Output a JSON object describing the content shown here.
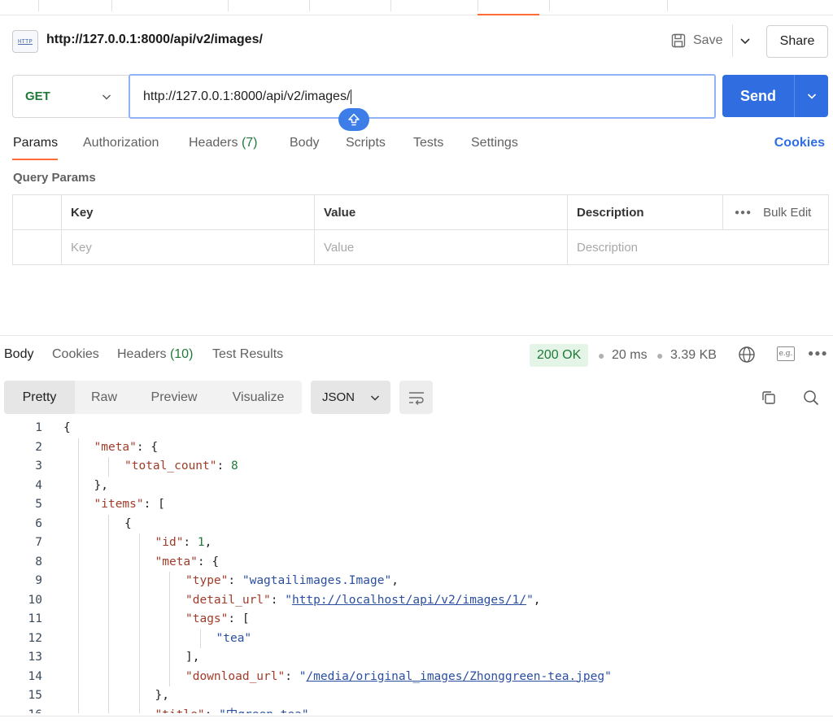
{
  "request": {
    "title": "http://127.0.0.1:8000/api/v2/images/",
    "http_icon_label": "HTTP",
    "save_label": "Save",
    "share_label": "Share",
    "method": "GET",
    "url": "http://127.0.0.1:8000/api/v2/images/",
    "send_label": "Send"
  },
  "request_tabs": {
    "params": "Params",
    "authorization": "Authorization",
    "headers": "Headers",
    "headers_count": "(7)",
    "body": "Body",
    "scripts": "Scripts",
    "tests": "Tests",
    "settings": "Settings",
    "cookies": "Cookies"
  },
  "query_params": {
    "label": "Query Params",
    "headers": {
      "key": "Key",
      "value": "Value",
      "description": "Description",
      "bulk_edit": "Bulk Edit"
    },
    "placeholders": {
      "key": "Key",
      "value": "Value",
      "description": "Description"
    }
  },
  "response": {
    "tabs": {
      "body": "Body",
      "cookies": "Cookies",
      "headers": "Headers",
      "headers_count": "(10)",
      "test_results": "Test Results"
    },
    "status": "200 OK",
    "time": "20 ms",
    "size": "3.39 KB",
    "eg_label": "e.g.",
    "views": {
      "pretty": "Pretty",
      "raw": "Raw",
      "preview": "Preview",
      "visualize": "Visualize"
    },
    "format": "JSON"
  },
  "code_lines": [
    {
      "n": "1",
      "indent": 0,
      "parts": [
        {
          "t": "p",
          "v": "{"
        }
      ]
    },
    {
      "n": "2",
      "indent": 1,
      "parts": [
        {
          "t": "k",
          "v": "\"meta\""
        },
        {
          "t": "p",
          "v": ": {"
        }
      ]
    },
    {
      "n": "3",
      "indent": 2,
      "parts": [
        {
          "t": "k",
          "v": "\"total_count\""
        },
        {
          "t": "p",
          "v": ": "
        },
        {
          "t": "n",
          "v": "8"
        }
      ]
    },
    {
      "n": "4",
      "indent": 1,
      "parts": [
        {
          "t": "p",
          "v": "},"
        }
      ]
    },
    {
      "n": "5",
      "indent": 1,
      "parts": [
        {
          "t": "k",
          "v": "\"items\""
        },
        {
          "t": "p",
          "v": ": ["
        }
      ]
    },
    {
      "n": "6",
      "indent": 2,
      "parts": [
        {
          "t": "p",
          "v": "{"
        }
      ]
    },
    {
      "n": "7",
      "indent": 3,
      "parts": [
        {
          "t": "k",
          "v": "\"id\""
        },
        {
          "t": "p",
          "v": ": "
        },
        {
          "t": "n",
          "v": "1"
        },
        {
          "t": "p",
          "v": ","
        }
      ]
    },
    {
      "n": "8",
      "indent": 3,
      "parts": [
        {
          "t": "k",
          "v": "\"meta\""
        },
        {
          "t": "p",
          "v": ": {"
        }
      ]
    },
    {
      "n": "9",
      "indent": 4,
      "parts": [
        {
          "t": "k",
          "v": "\"type\""
        },
        {
          "t": "p",
          "v": ": "
        },
        {
          "t": "s",
          "v": "\"wagtailimages.Image\""
        },
        {
          "t": "p",
          "v": ","
        }
      ]
    },
    {
      "n": "10",
      "indent": 4,
      "parts": [
        {
          "t": "k",
          "v": "\"detail_url\""
        },
        {
          "t": "p",
          "v": ": "
        },
        {
          "t": "s",
          "v": "\""
        },
        {
          "t": "u",
          "v": "http://localhost/api/v2/images/1/"
        },
        {
          "t": "s",
          "v": "\""
        },
        {
          "t": "p",
          "v": ","
        }
      ]
    },
    {
      "n": "11",
      "indent": 4,
      "parts": [
        {
          "t": "k",
          "v": "\"tags\""
        },
        {
          "t": "p",
          "v": ": ["
        }
      ]
    },
    {
      "n": "12",
      "indent": 5,
      "parts": [
        {
          "t": "s",
          "v": "\"tea\""
        }
      ]
    },
    {
      "n": "13",
      "indent": 4,
      "parts": [
        {
          "t": "p",
          "v": "],"
        }
      ]
    },
    {
      "n": "14",
      "indent": 4,
      "parts": [
        {
          "t": "k",
          "v": "\"download_url\""
        },
        {
          "t": "p",
          "v": ": "
        },
        {
          "t": "s",
          "v": "\""
        },
        {
          "t": "u",
          "v": "/media/original_images/Zhonggreen-tea.jpeg"
        },
        {
          "t": "s",
          "v": "\""
        }
      ]
    },
    {
      "n": "15",
      "indent": 3,
      "parts": [
        {
          "t": "p",
          "v": "},"
        }
      ]
    },
    {
      "n": "16",
      "indent": 3,
      "parts": [
        {
          "t": "k",
          "v": "\"title\""
        },
        {
          "t": "p",
          "v": ": "
        },
        {
          "t": "s",
          "v": "\"中green-tea\""
        }
      ]
    }
  ]
}
